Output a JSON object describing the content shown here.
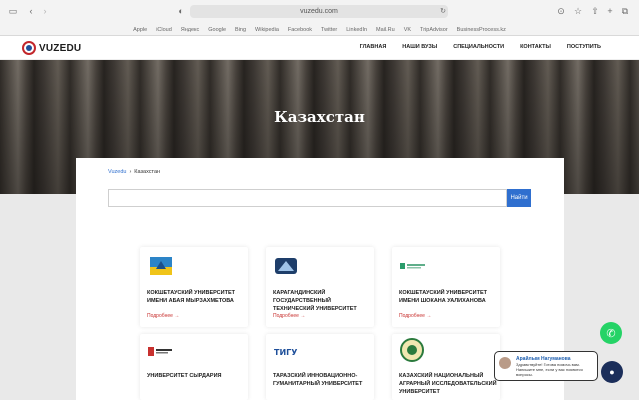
{
  "browser": {
    "url": "vuzedu.com",
    "bookmarks": [
      "Apple",
      "iCloud",
      "Яндекс",
      "Google",
      "Bing",
      "Wikipedia",
      "Facebook",
      "Twitter",
      "LinkedIn",
      "Mail.Ru",
      "VK",
      "TripAdvisor",
      "BusinessProcess.kz"
    ]
  },
  "header": {
    "logo": "VUZEDU",
    "nav": [
      "ГЛАВНАЯ",
      "НАШИ ВУЗЫ",
      "СПЕЦИАЛЬНОСТИ",
      "КОНТАКТЫ",
      "ПОСТУПИТЬ"
    ]
  },
  "hero": {
    "title": "Казахстан"
  },
  "breadcrumb": {
    "home": "Vuzedu",
    "sep": "›",
    "current": "Казахстан"
  },
  "search": {
    "placeholder": "",
    "button": "Найти"
  },
  "cards": [
    {
      "title": "КОКШЕТАУСКИЙ УНИВЕРСИТЕТ ИМЕНИ АБАЯ МЫРЗАХМЕТОВА",
      "more": "Подробнее →"
    },
    {
      "title": "КАРАГАНДИНСКИЙ ГОСУДАРСТВЕННЫЙ ТЕХНИЧЕСКИЙ УНИВЕРСИТЕТ",
      "more": "Подробнее →"
    },
    {
      "title": "КОКШЕТАУСКИЙ УНИВЕРСИТЕТ ИМЕНИ ШОКАНА УАЛИХАНОВА",
      "more": "Подробнее →"
    },
    {
      "title": "УНИВЕРСИТЕТ СЫРДАРИЯ",
      "more": ""
    },
    {
      "title": "ТАРАЗСКИЙ ИННОВАЦИОННО-ГУМАНИТАРНЫЙ УНИВЕРСИТЕТ",
      "more": ""
    },
    {
      "title": "КАЗАХСКИЙ НАЦИОНАЛЬНЫЙ АГРАРНЫЙ ИССЛЕДОВАТЕЛЬСКИЙ УНИВЕРСИТЕТ",
      "more": ""
    }
  ],
  "chat": {
    "name": "Арайлым Нагуманова",
    "message": "Здравствуйте! Готова помочь вам. Напишите мне, если у вас появятся вопросы."
  },
  "colors": {
    "accent": "#2f6fcf",
    "brand_red": "#c2262b",
    "whatsapp": "#25d366"
  }
}
